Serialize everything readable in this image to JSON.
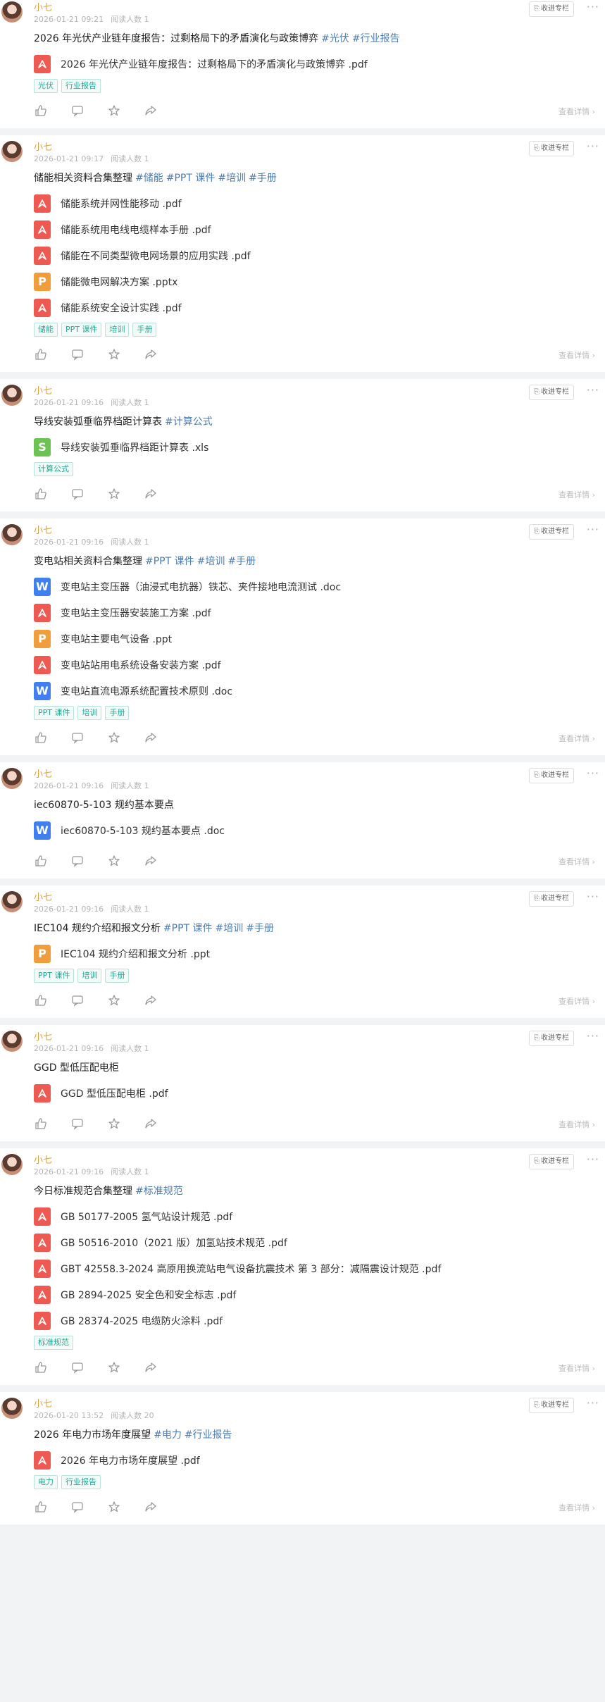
{
  "ui": {
    "collect_label": "收进专栏",
    "more_label": "···",
    "detail_label": "查看详情 ›",
    "read_prefix": "阅读人数"
  },
  "icons": {
    "like": "thumbs-up-icon",
    "comment": "comment-icon",
    "favorite": "star-icon",
    "share": "share-icon",
    "collect": "bookmark-icon"
  },
  "colors": {
    "pdf": "#ee5a52",
    "doc": "#3f7ff0",
    "ppt": "#f29d3c",
    "xls": "#6cc253",
    "author": "#e0a03a",
    "hashtag": "#4c7cb5",
    "chip": "#24a895"
  },
  "posts": [
    {
      "author": "小七",
      "time": "2026-01-21 09:21",
      "reads": "阅读人数 1",
      "title": "2026 年光伏产业链年度报告：过剩格局下的矛盾演化与政策博弈",
      "tags": [
        "#光伏",
        "#行业报告"
      ],
      "files": [
        {
          "type": "pdf",
          "letter": "",
          "name": "2026 年光伏产业链年度报告：过剩格局下的矛盾演化与政策博弈 .pdf"
        }
      ],
      "chips": [
        "光伏",
        "行业报告"
      ]
    },
    {
      "author": "小七",
      "time": "2026-01-21 09:17",
      "reads": "阅读人数 1",
      "title": "储能相关资料合集整理",
      "tags": [
        "#储能",
        "#PPT 课件",
        "#培训",
        "#手册"
      ],
      "files": [
        {
          "type": "pdf",
          "letter": "",
          "name": "储能系统并网性能移动 .pdf"
        },
        {
          "type": "pdf",
          "letter": "",
          "name": "储能系统用电线电缆样本手册 .pdf"
        },
        {
          "type": "pdf",
          "letter": "",
          "name": "储能在不同类型微电网场景的应用实践 .pdf"
        },
        {
          "type": "ppt",
          "letter": "P",
          "name": "储能微电网解决方案 .pptx"
        },
        {
          "type": "pdf",
          "letter": "",
          "name": "储能系统安全设计实践 .pdf"
        }
      ],
      "chips": [
        "储能",
        "PPT 课件",
        "培训",
        "手册"
      ]
    },
    {
      "author": "小七",
      "time": "2026-01-21 09:16",
      "reads": "阅读人数 1",
      "title": "导线安装弧垂临界档距计算表",
      "tags": [
        "#计算公式"
      ],
      "files": [
        {
          "type": "xls",
          "letter": "S",
          "name": "导线安装弧垂临界档距计算表 .xls"
        }
      ],
      "chips": [
        "计算公式"
      ]
    },
    {
      "author": "小七",
      "time": "2026-01-21 09:16",
      "reads": "阅读人数 1",
      "title": "变电站相关资料合集整理",
      "tags": [
        "#PPT 课件",
        "#培训",
        "#手册"
      ],
      "files": [
        {
          "type": "doc",
          "letter": "W",
          "name": "变电站主变压器（油浸式电抗器）铁芯、夹件接地电流测试 .doc"
        },
        {
          "type": "pdf",
          "letter": "",
          "name": "变电站主变压器安装施工方案 .pdf"
        },
        {
          "type": "ppt",
          "letter": "P",
          "name": "变电站主要电气设备 .ppt"
        },
        {
          "type": "pdf",
          "letter": "",
          "name": "变电站站用电系统设备安装方案 .pdf"
        },
        {
          "type": "doc",
          "letter": "W",
          "name": "变电站直流电源系统配置技术原则 .doc"
        }
      ],
      "chips": [
        "PPT 课件",
        "培训",
        "手册"
      ]
    },
    {
      "author": "小七",
      "time": "2026-01-21 09:16",
      "reads": "阅读人数 1",
      "title": "iec60870-5-103 规约基本要点",
      "tags": [],
      "files": [
        {
          "type": "doc",
          "letter": "W",
          "name": "iec60870-5-103 规约基本要点 .doc"
        }
      ],
      "chips": []
    },
    {
      "author": "小七",
      "time": "2026-01-21 09:16",
      "reads": "阅读人数 1",
      "title": "IEC104 规约介绍和报文分析",
      "tags": [
        "#PPT 课件",
        "#培训",
        "#手册"
      ],
      "files": [
        {
          "type": "ppt",
          "letter": "P",
          "name": "IEC104 规约介绍和报文分析 .ppt"
        }
      ],
      "chips": [
        "PPT 课件",
        "培训",
        "手册"
      ]
    },
    {
      "author": "小七",
      "time": "2026-01-21 09:16",
      "reads": "阅读人数 1",
      "title": "GGD 型低压配电柜",
      "tags": [],
      "files": [
        {
          "type": "pdf",
          "letter": "",
          "name": "GGD 型低压配电柜 .pdf"
        }
      ],
      "chips": []
    },
    {
      "author": "小七",
      "time": "2026-01-21 09:16",
      "reads": "阅读人数 1",
      "title": "今日标准规范合集整理",
      "tags": [
        "#标准规范"
      ],
      "files": [
        {
          "type": "pdf",
          "letter": "",
          "name": "GB 50177-2005 氢气站设计规范 .pdf"
        },
        {
          "type": "pdf",
          "letter": "",
          "name": "GB 50516-2010（2021 版）加氢站技术规范 .pdf"
        },
        {
          "type": "pdf",
          "letter": "",
          "name": "GBT 42558.3-2024 高原用换流站电气设备抗震技术 第 3 部分：减隔震设计规范 .pdf"
        },
        {
          "type": "pdf",
          "letter": "",
          "name": "GB 2894-2025 安全色和安全标志 .pdf"
        },
        {
          "type": "pdf",
          "letter": "",
          "name": "GB 28374-2025 电缆防火涂料 .pdf"
        }
      ],
      "chips": [
        "标准规范"
      ]
    },
    {
      "author": "小七",
      "time": "2026-01-20 13:52",
      "reads": "阅读人数 20",
      "title": "2026 年电力市场年度展望",
      "tags": [
        "#电力",
        "#行业报告"
      ],
      "files": [
        {
          "type": "pdf",
          "letter": "",
          "name": "2026 年电力市场年度展望 .pdf"
        }
      ],
      "chips": [
        "电力",
        "行业报告"
      ]
    }
  ]
}
